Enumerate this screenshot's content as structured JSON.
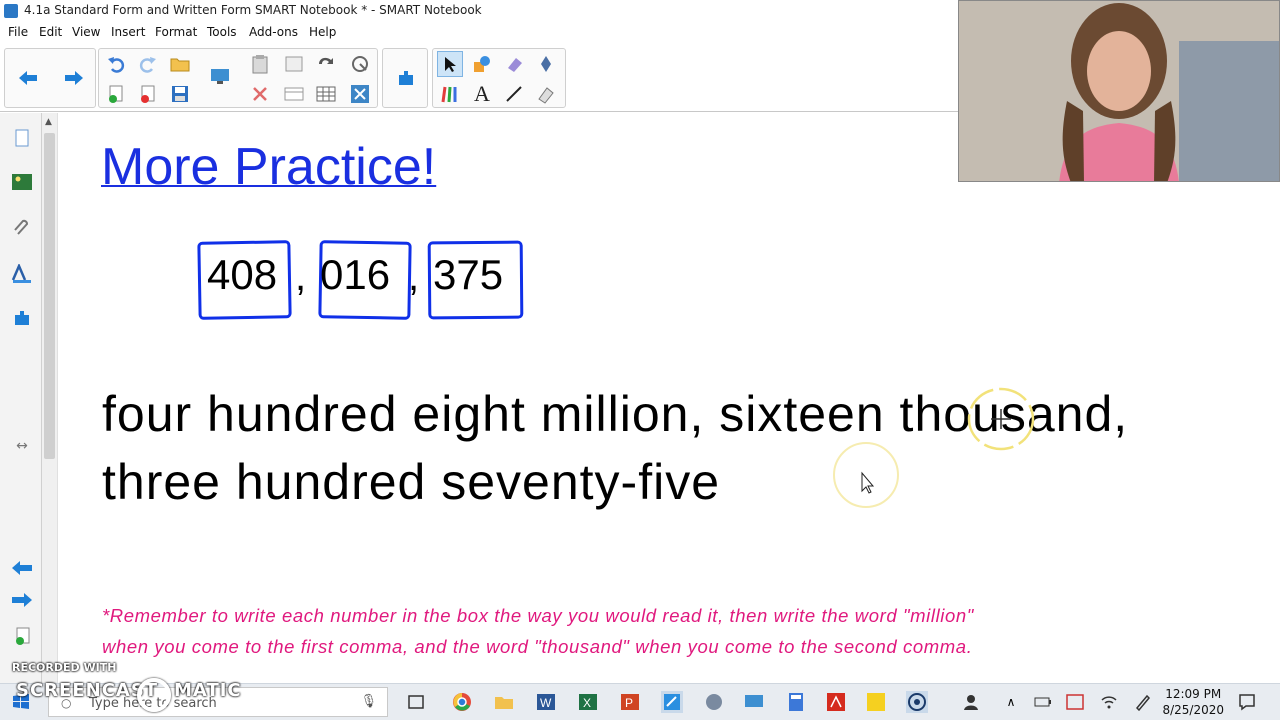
{
  "window": {
    "title": "4.1a Standard Form and Written Form SMART Notebook * - SMART Notebook"
  },
  "menu": [
    "File",
    "Edit",
    "View",
    "Insert",
    "Format",
    "Tools",
    "Add-ons",
    "Help"
  ],
  "toolbar": {
    "items": [
      "back-icon",
      "forward-icon",
      "undo-icon",
      "redo-icon",
      "open-icon",
      "screen-shade-icon",
      "paste-icon",
      "page-icon",
      "capture-icon",
      "measurement-icon",
      "add-page-icon",
      "delete-page-icon",
      "save-icon",
      "dual-page-icon",
      "delete-icon",
      "screen-icon",
      "table-icon",
      "close-icon",
      "addons-icon",
      "select-icon",
      "pens-icon",
      "eraser-icon",
      "magic-pen-icon",
      "creative-pens-icon",
      "text-icon",
      "line-icon",
      "fill-icon"
    ]
  },
  "page": {
    "heading": "More Practice!",
    "numbers": [
      "408",
      "016",
      "375"
    ],
    "separator": ",",
    "words_line1": "four hundred eight million, sixteen thousand,",
    "words_line2": "three hundred seventy-five",
    "note_line1": "*Remember to write each number in the box the way you would read it, then write the word \"million\"",
    "note_line2": "when you come to the first comma, and the word \"thousand\" when you come to the second comma."
  },
  "watermark": {
    "line1": "RECORDED WITH",
    "line2": "SCREENCAST",
    "line3": "MATIC"
  },
  "taskbar": {
    "search_placeholder": "Type here to search",
    "time": "12:09 PM",
    "date": "8/25/2020"
  },
  "colors": {
    "heading": "#1a2fe0",
    "box": "#1030e8",
    "note": "#e0197e",
    "highlight": "#f2e27a"
  }
}
